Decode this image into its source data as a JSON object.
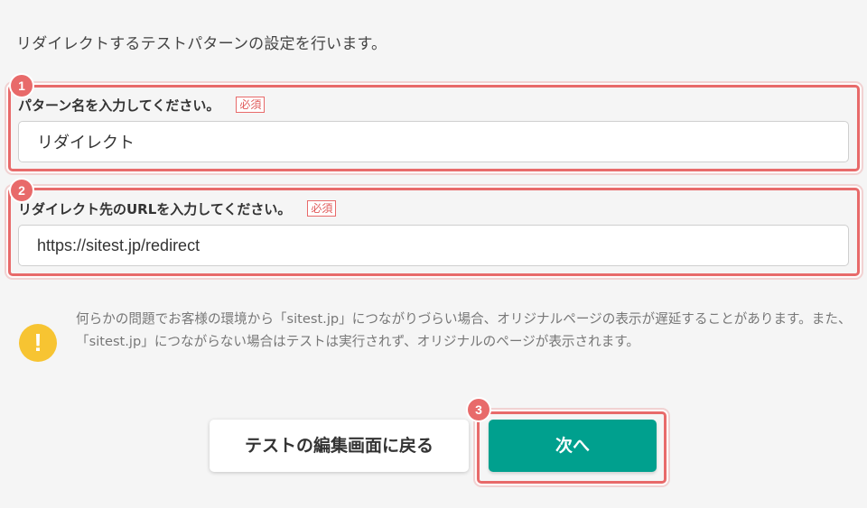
{
  "intro": "リダイレクトするテストパターンの設定を行います。",
  "steps": [
    "1",
    "2",
    "3"
  ],
  "pattern_name": {
    "label": "パターン名を入力してください。",
    "required": "必須",
    "value": "リダイレクト"
  },
  "redirect_url": {
    "label": "リダイレクト先のURLを入力してください。",
    "required": "必須",
    "value": "https://sitest.jp/redirect"
  },
  "notice": {
    "icon": "exclamation-icon",
    "icon_glyph": "!",
    "text": "何らかの問題でお客様の環境から「sitest.jp」につながりづらい場合、オリジナルページの表示が遅延することがあります。また、「sitest.jp」につながらない場合はテストは実行されず、オリジナルのページが表示されます。"
  },
  "buttons": {
    "back": "テストの編集画面に戻る",
    "next": "次へ"
  },
  "colors": {
    "accent": "#00a08e",
    "highlight": "#e86a6a",
    "warning": "#f7c432"
  }
}
